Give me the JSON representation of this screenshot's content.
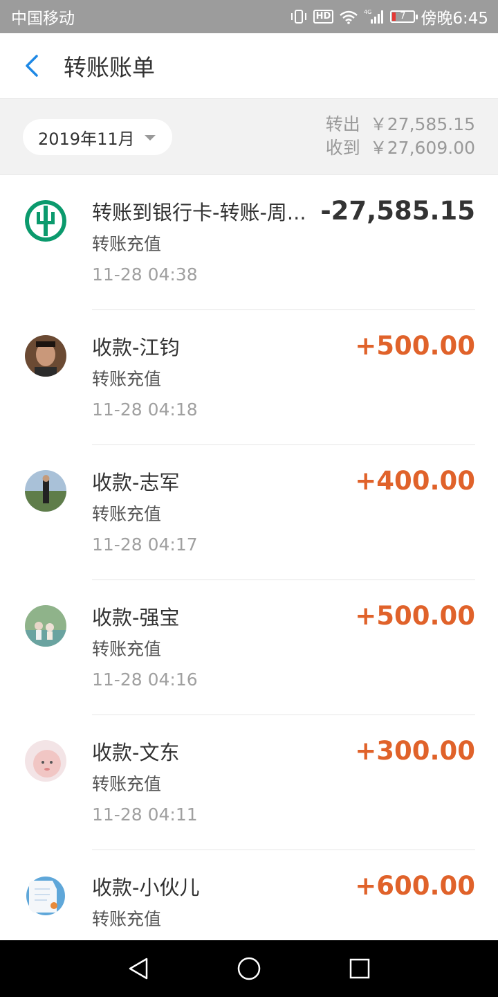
{
  "status_bar": {
    "carrier": "中国移动",
    "hd": "HD",
    "network": "4G",
    "battery": "7",
    "time": "傍晚6:45"
  },
  "header": {
    "title": "转账账单",
    "back_icon": "chevron-left-icon"
  },
  "summary": {
    "month": "2019年11月",
    "out_label": "转出",
    "out_value": "￥27,585.15",
    "in_label": "收到",
    "in_value": "￥27,609.00"
  },
  "items": [
    {
      "name": "转账到银行卡-转账-周...",
      "category": "转账充值",
      "time": "11-28  04:38",
      "amount": "-27,585.15",
      "direction": "out",
      "avatar": "bank-logo"
    },
    {
      "name": "收款-江钧",
      "category": "转账充值",
      "time": "11-28  04:18",
      "amount": "+500.00",
      "direction": "in",
      "avatar": "user-photo"
    },
    {
      "name": "收款-志军",
      "category": "转账充值",
      "time": "11-28  04:17",
      "amount": "+400.00",
      "direction": "in",
      "avatar": "user-photo"
    },
    {
      "name": "收款-强宝",
      "category": "转账充值",
      "time": "11-28  04:16",
      "amount": "+500.00",
      "direction": "in",
      "avatar": "user-photo"
    },
    {
      "name": "收款-文东",
      "category": "转账充值",
      "time": "11-28  04:11",
      "amount": "+300.00",
      "direction": "in",
      "avatar": "user-photo"
    },
    {
      "name": "收款-小伙儿",
      "category": "转账充值",
      "time": "",
      "amount": "+600.00",
      "direction": "in",
      "avatar": "user-photo"
    }
  ],
  "colors": {
    "income": "#e0622a",
    "expense": "#333333",
    "accent": "#1e88e5"
  },
  "nav_bar": {
    "back_icon": "triangle-back-icon",
    "home_icon": "circle-home-icon",
    "recents_icon": "square-recents-icon"
  }
}
